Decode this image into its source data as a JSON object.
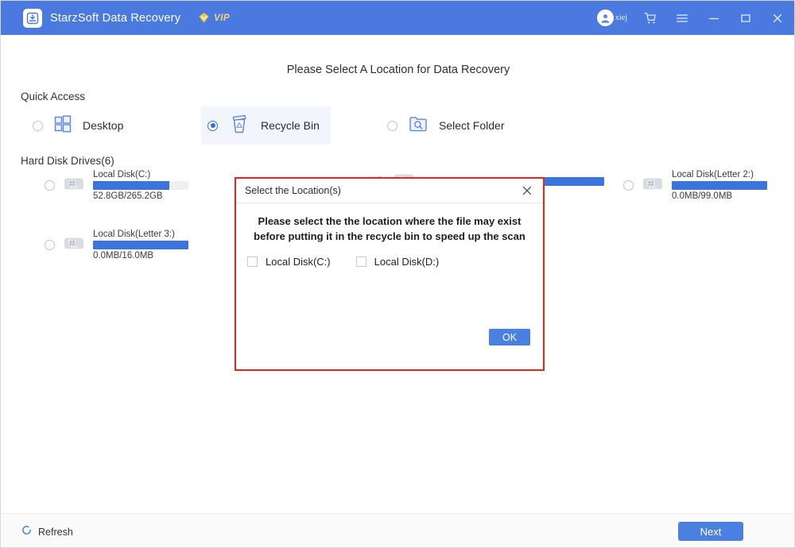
{
  "titlebar": {
    "app_name": "StarzSoft Data Recovery",
    "vip_label": "VIP",
    "account_name": "xiej",
    "icons": {
      "logo": "download-box-icon",
      "vip": "vip-diamond-icon",
      "avatar": "user-avatar-icon",
      "cart": "shopping-cart-icon",
      "menu": "hamburger-menu-icon",
      "minimize": "minimize-icon",
      "maximize": "maximize-icon",
      "close": "close-icon"
    },
    "background_color": "#4a7ae0"
  },
  "main": {
    "page_title": "Please Select A Location for Data Recovery",
    "quick_access_label": "Quick Access",
    "quick_access": [
      {
        "label": "Desktop",
        "icon": "windows-logo-icon",
        "selected": false
      },
      {
        "label": "Recycle Bin",
        "icon": "recycle-bin-icon",
        "selected": true
      },
      {
        "label": "Select Folder",
        "icon": "folder-search-icon",
        "selected": false
      }
    ],
    "hard_disk_label": "Hard Disk Drives(6)",
    "drives": [
      {
        "name": "Local Disk(C:)",
        "usage": "52.8GB/265.2GB",
        "fill_percent": 80,
        "selected": false
      },
      {
        "name": "Local Disk(Letter 3:)",
        "usage": "0.0MB/16.0MB",
        "fill_percent": 100,
        "selected": false
      },
      {
        "name": "Local Disk(Letter 2:)",
        "usage": "0.0MB/99.0MB",
        "fill_percent": 100,
        "selected": false
      }
    ]
  },
  "dialog": {
    "title": "Select the Location(s)",
    "message": "Please select the the location where the file may exist before putting it in the recycle bin to speed up the scan",
    "checkboxes": [
      {
        "label": "Local Disk(C:)",
        "checked": false
      },
      {
        "label": "Local Disk(D:)",
        "checked": false
      }
    ],
    "ok_label": "OK",
    "border_color": "#f52015"
  },
  "footer": {
    "refresh_label": "Refresh",
    "next_label": "Next",
    "accent_color": "#4a80e2"
  }
}
